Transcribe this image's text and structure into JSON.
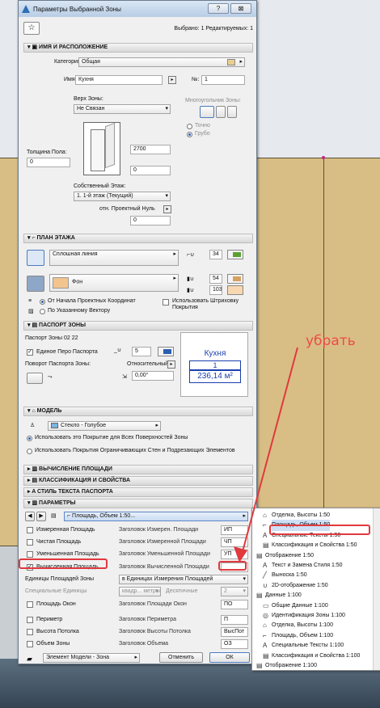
{
  "window": {
    "title": "Параметры Выбранной Зоны",
    "help_btn": "?",
    "close_btn": "⊠"
  },
  "header": {
    "fav_icon": "☆",
    "selection": "Выбрано: 1 Редактируемых: 1"
  },
  "sections": {
    "name_location": "ИМЯ И РАСПОЛОЖЕНИЕ",
    "floor_plan": "ПЛАН ЭТАЖА",
    "stamp": "ПАСПОРТ ЗОНЫ",
    "model": "МОДЕЛЬ",
    "area_calc": "ВЫЧИСЛЕНИЕ ПЛОЩАДИ",
    "classification": "КЛАССИФИКАЦИЯ И СВОЙСТВА",
    "text_style": "СТИЛЬ ТЕКСТА ПАСПОРТА",
    "params": "ПАРАМЕТРЫ"
  },
  "name_loc": {
    "category_label": "Категория:",
    "category_value": "Общая",
    "name_label": "Имя:",
    "name_value": "Кухня",
    "num_label": "№:",
    "num_value": "1",
    "top_label": "Верх Зоны:",
    "top_value": "Не Связан",
    "poly_label": "Многоугольник Зоны:",
    "precise": "Точно",
    "rough": "Грубо",
    "height_value": "2700",
    "floor_thick_label": "Толщина Пола:",
    "floor_thick_value": "0",
    "offset_value": "0",
    "story_label": "Собственный Этаж:",
    "story_value": "1. 1-й этаж (Текущий)",
    "ref_label": "отн. Проектный Нуль",
    "ref_value": "0"
  },
  "floor_plan": {
    "line_value": "Сплошная линия",
    "pen1": "34",
    "fill_value": "Фон",
    "pen2": "54",
    "pen3": "103",
    "origin1": "От Начала Проектных Координат",
    "origin2": "По Указанному Вектору",
    "hatch_label": "Использовать Штриховку Покрытия"
  },
  "stamp": {
    "name": "Паспорт Зоны 02 22",
    "single_pen": "Единое Перо Паспорта",
    "pen_value": "5",
    "rotate_label": "Поворот Паспорта Зоны:",
    "relative": "Относительный",
    "angle": "0,00°",
    "preview_name": "Кухня",
    "preview_num": "1",
    "preview_area": "236,14 м²"
  },
  "model": {
    "surface": "Стекло - Голубое",
    "opt1": "Использовать это Покрытие для Всех Поверхностей Зоны",
    "opt2": "Использовать Покрытия Ограничивающих Стен и Подрезающих Элементов"
  },
  "params": {
    "selector": "Площадь, Объем 1:50...",
    "rows": [
      {
        "name": "Измеренная Площадь",
        "head": "Заголовок Измерен. Площади",
        "val": "ИП",
        "checked": false
      },
      {
        "name": "Чистая Площадь",
        "head": "Заголовок Измеренной Площади",
        "val": "ЧП",
        "checked": false
      },
      {
        "name": "Уменьшенная Площадь",
        "head": "Заголовок Уменьшенной Площади",
        "val": "УП",
        "checked": false
      },
      {
        "name": "Вычисленная Площадь",
        "head": "Заголовок Вычисленной Площади",
        "val": "",
        "checked": true
      }
    ],
    "units_label": "Единицы Площадей Зоны",
    "units_value": "в Единицах Измерения Площадей",
    "special_label": "Специальные Единицы",
    "special_value": "квадр... метры",
    "decimals_label": "Десятичные",
    "decimals_value": "2",
    "rows2": [
      {
        "name": "Площадь Окон",
        "head": "Заголовок Площади Окон",
        "val": "ПО",
        "checked": false
      },
      {
        "name": "Периметр",
        "head": "Заголовок Периметра",
        "val": "П",
        "checked": false
      },
      {
        "name": "Высота Потолка",
        "head": "Заголовок Высоты Потолка",
        "val": "ВысПот",
        "checked": false
      },
      {
        "name": "Объем Зоны",
        "head": "Заголовок Объема",
        "val": "ОЗ",
        "checked": false
      }
    ]
  },
  "footer": {
    "layer": "Элемент Модели - Зона",
    "cancel": "Отменить",
    "ok": "ОК"
  },
  "popup": [
    {
      "label": "Отделка, Высоты 1:50",
      "icon": "⌂"
    },
    {
      "label": "Площадь, Объем 1:50",
      "icon": "⌐"
    },
    {
      "label": "Специальные Тексты 1:50",
      "icon": "A"
    },
    {
      "label": "Классификация и Свойства 1:50",
      "icon": "▤"
    },
    {
      "label": "Отображение 1:50",
      "icon": "▤"
    },
    {
      "label": "Текст и Замена Стиля 1:50",
      "icon": "A"
    },
    {
      "label": "Выноска 1:50",
      "icon": "╱"
    },
    {
      "label": "2D-отображение 1:50",
      "icon": "∪"
    },
    {
      "label": "Данные 1:100",
      "icon": "▤"
    },
    {
      "label": "Общие Данные 1:100",
      "icon": "▭"
    },
    {
      "label": "Идентификация Зоны 1:100",
      "icon": "◎"
    },
    {
      "label": "Отделка, Высоты 1:100",
      "icon": "⌂"
    },
    {
      "label": "Площадь, Объем 1:100",
      "icon": "⌐"
    },
    {
      "label": "Специальные Тексты 1:100",
      "icon": "A"
    },
    {
      "label": "Классификация и Свойства 1:100",
      "icon": "▤"
    },
    {
      "label": "Отображение 1:100",
      "icon": "▤"
    }
  ],
  "annotation": "убрать",
  "colors": {
    "accent": "#2a5fb0",
    "annot_red": "#e0393e",
    "plan_tan": "#d8be85"
  }
}
